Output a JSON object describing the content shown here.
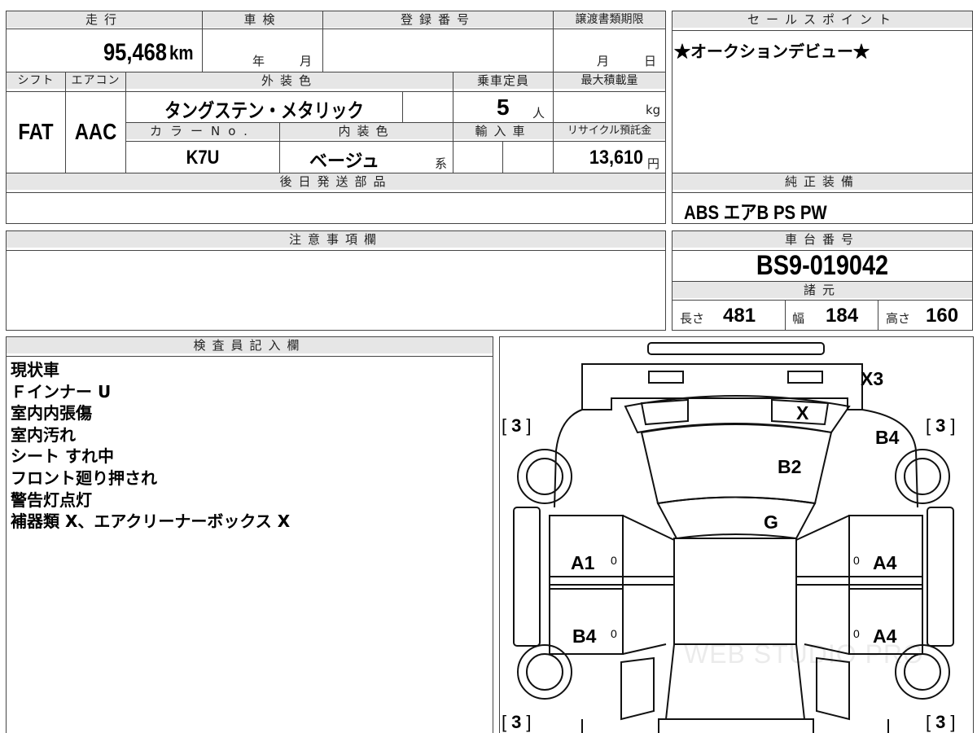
{
  "top_form": {
    "mileage": {
      "label": "走行",
      "value": "95,468",
      "unit": "km"
    },
    "inspection": {
      "label": "車検",
      "year_unit": "年",
      "month_unit": "月"
    },
    "registration": {
      "label": "登録番号",
      "value": ""
    },
    "transfer_deadline": {
      "label": "譲渡書類期限",
      "month_unit": "月",
      "day_unit": "日"
    },
    "shift": {
      "label": "シフト",
      "value": "FAT"
    },
    "aircon": {
      "label": "エアコン",
      "value": "AAC"
    },
    "exterior_color": {
      "label": "外装色",
      "value": "タングステン・メタリック"
    },
    "capacity": {
      "label": "乗車定員",
      "value": "5",
      "unit": "人"
    },
    "max_load": {
      "label": "最大積載量",
      "unit": "kg"
    },
    "color_no": {
      "label": "カラーNo.",
      "value": "K7U"
    },
    "interior_color": {
      "label": "内装色",
      "value": "ベージュ",
      "suffix": "系"
    },
    "import": {
      "label": "輸入車"
    },
    "recycle_fee": {
      "label": "リサイクル預託金",
      "value": "13,610",
      "unit": "円"
    },
    "later_parts": {
      "label": "後日発送部品",
      "value": ""
    }
  },
  "sales_point": {
    "label": "セールスポイント",
    "text": "★オークションデビュー★"
  },
  "equipment": {
    "label": "純正装備",
    "text": "ABS エアB PS PW"
  },
  "notes": {
    "label": "注意事項欄",
    "text": ""
  },
  "chassis": {
    "label": "車台番号",
    "value": "BS9-019042"
  },
  "specs": {
    "label": "諸元",
    "length_label": "長さ",
    "length": "481",
    "width_label": "幅",
    "width": "184",
    "height_label": "高さ",
    "height": "160"
  },
  "inspector": {
    "label": "検査員記入欄",
    "lines": [
      "現状車",
      "Ｆインナー U",
      "室内内張傷",
      "室内汚れ",
      "シート すれ中",
      "フロント廻り押され",
      "警告灯点灯",
      "補器類 X、エアクリーナーボックス X"
    ]
  },
  "diagram": {
    "marks": {
      "rear_bumper": "X3",
      "rear_glass": "X",
      "roof": "B2",
      "front_glass": "G",
      "left_front_door": "A1",
      "left_rear_door": "B4",
      "right_front_door": "A4",
      "right_rear_door": "A4",
      "right_rear_fender": "B4"
    },
    "tire_depths": {
      "rear_left": "3",
      "rear_right": "3",
      "front_left": "3",
      "front_right": "3"
    },
    "door_zeros": [
      "0",
      "0",
      "0",
      "0"
    ],
    "watermark": "WEB STUDIO PRO"
  }
}
